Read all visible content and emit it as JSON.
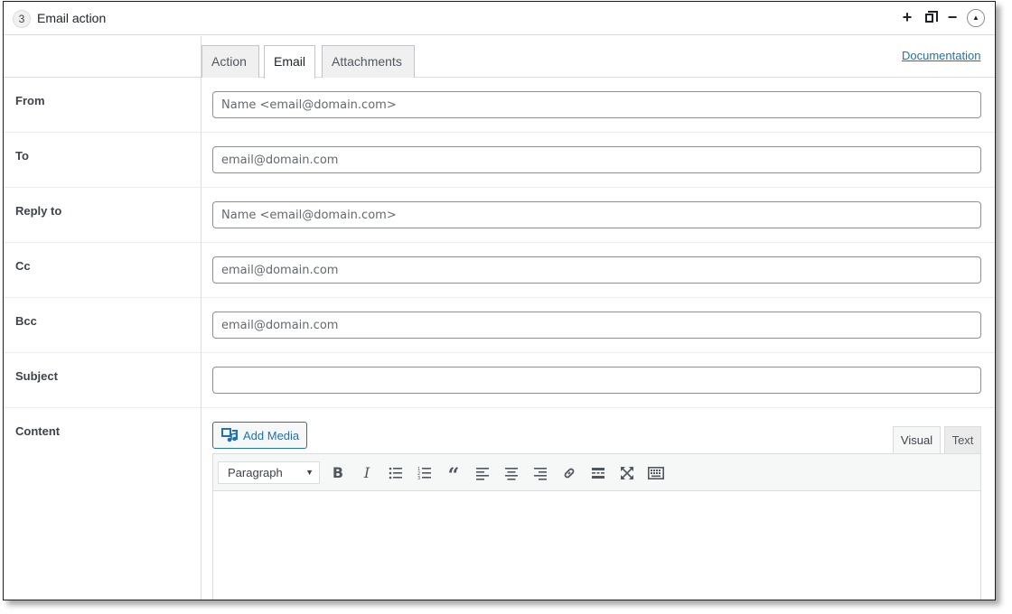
{
  "header": {
    "step_number": "3",
    "title": "Email action"
  },
  "tabs": [
    {
      "label": "Action"
    },
    {
      "label": "Email"
    },
    {
      "label": "Attachments"
    }
  ],
  "documentation_link": "Documentation",
  "fields": {
    "from": {
      "label": "From",
      "placeholder": "Name <email@domain.com>",
      "value": ""
    },
    "to": {
      "label": "To",
      "placeholder": "email@domain.com",
      "value": ""
    },
    "reply_to": {
      "label": "Reply to",
      "placeholder": "Name <email@domain.com>",
      "value": ""
    },
    "cc": {
      "label": "Cc",
      "placeholder": "email@domain.com",
      "value": ""
    },
    "bcc": {
      "label": "Bcc",
      "placeholder": "email@domain.com",
      "value": ""
    },
    "subject": {
      "label": "Subject",
      "placeholder": "",
      "value": ""
    }
  },
  "content": {
    "label": "Content",
    "add_media_label": "Add Media",
    "editor_tabs": {
      "visual": "Visual",
      "text": "Text"
    },
    "format_select": "Paragraph",
    "toolbar_icons": [
      "bold-icon",
      "italic-icon",
      "bulleted-list-icon",
      "numbered-list-icon",
      "blockquote-icon",
      "align-left-icon",
      "align-center-icon",
      "align-right-icon",
      "link-icon",
      "read-more-icon",
      "fullscreen-icon",
      "toolbar-toggle-icon"
    ]
  },
  "colors": {
    "accent": "#2271b1",
    "border": "#8c8f94",
    "tab_bg": "#f0f0f1"
  }
}
